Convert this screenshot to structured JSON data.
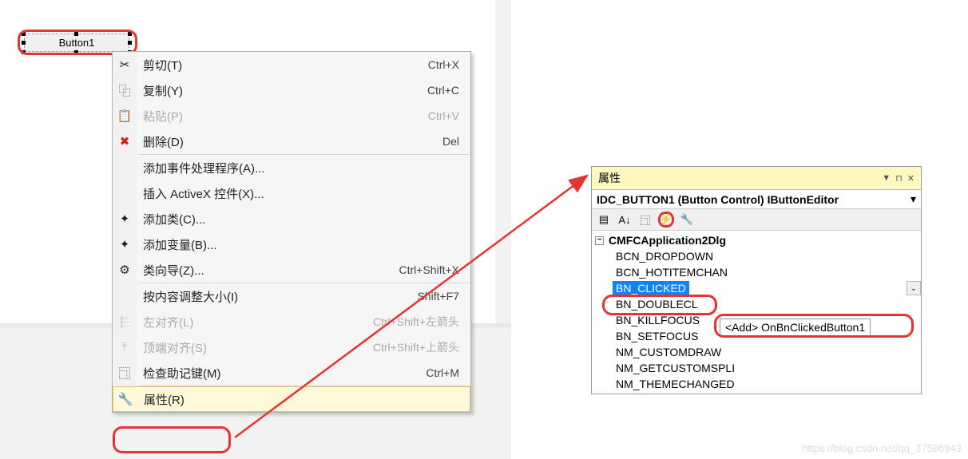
{
  "button_control": {
    "label": "Button1"
  },
  "context_menu": {
    "items": [
      {
        "icon": "cut-icon",
        "glyph": "✂",
        "label": "剪切(T)",
        "shortcut": "Ctrl+X",
        "disabled": false
      },
      {
        "icon": "copy-icon",
        "glyph": "⿻",
        "label": "复制(Y)",
        "shortcut": "Ctrl+C",
        "disabled": false
      },
      {
        "icon": "paste-icon",
        "glyph": "📋",
        "label": "粘贴(P)",
        "shortcut": "Ctrl+V",
        "disabled": true
      },
      {
        "icon": "delete-icon",
        "glyph": "✖",
        "label": "删除(D)",
        "shortcut": "Del",
        "disabled": false,
        "icon_color": "#c22"
      }
    ],
    "items2": [
      {
        "icon": "",
        "glyph": "",
        "label": "添加事件处理程序(A)...",
        "shortcut": "",
        "disabled": false
      },
      {
        "icon": "",
        "glyph": "",
        "label": "插入 ActiveX 控件(X)...",
        "shortcut": "",
        "disabled": false
      },
      {
        "icon": "add-class-icon",
        "glyph": "✦",
        "label": "添加类(C)...",
        "shortcut": "",
        "disabled": false
      },
      {
        "icon": "add-var-icon",
        "glyph": "✦",
        "label": "添加变量(B)...",
        "shortcut": "",
        "disabled": false
      },
      {
        "icon": "class-wizard-icon",
        "glyph": "⚙",
        "label": "类向导(Z)...",
        "shortcut": "Ctrl+Shift+X",
        "disabled": false
      }
    ],
    "items3": [
      {
        "icon": "",
        "glyph": "",
        "label": "按内容调整大小(I)",
        "shortcut": "Shift+F7",
        "disabled": false
      },
      {
        "icon": "align-left-icon",
        "glyph": "⬱",
        "label": "左对齐(L)",
        "shortcut": "Ctrl+Shift+左箭头",
        "disabled": true
      },
      {
        "icon": "align-top-icon",
        "glyph": "⤒",
        "label": "顶端对齐(S)",
        "shortcut": "Ctrl+Shift+上箭头",
        "disabled": true
      },
      {
        "icon": "mnemonic-icon",
        "glyph": "⿹",
        "label": "检查助记键(M)",
        "shortcut": "Ctrl+M",
        "disabled": false
      }
    ],
    "items4": [
      {
        "icon": "wrench-icon",
        "glyph": "🔧",
        "label": "属性(R)",
        "shortcut": "",
        "disabled": false,
        "highlighted": true
      }
    ]
  },
  "props": {
    "title": "属性",
    "subtitle": "IDC_BUTTON1 (Button Control) IButtonEditor",
    "toolbar": [
      {
        "name": "categorized-icon",
        "glyph": "▤"
      },
      {
        "name": "alpha-sort-icon",
        "glyph": "A↓"
      },
      {
        "name": "control-events-icon",
        "glyph": "⿹"
      },
      {
        "name": "lightning-icon",
        "glyph": "⚡",
        "highlighted": true
      },
      {
        "name": "wrench-icon",
        "glyph": "🔧"
      }
    ],
    "tree_header": "CMFCApplication2Dlg",
    "events": [
      {
        "key": "BCN_DROPDOWN"
      },
      {
        "key": "BCN_HOTITEMCHAN"
      },
      {
        "key": "BN_CLICKED",
        "selected": true
      },
      {
        "key": "BN_DOUBLECL"
      },
      {
        "key": "BN_KILLFOCUS"
      },
      {
        "key": "BN_SETFOCUS"
      },
      {
        "key": "NM_CUSTOMDRAW"
      },
      {
        "key": "NM_GETCUSTOMSPLI"
      },
      {
        "key": "NM_THEMECHANGED"
      }
    ],
    "add_tooltip": "<Add> OnBnClickedButton1"
  },
  "watermark": "https://blog.csdn.net/qq_37596943"
}
